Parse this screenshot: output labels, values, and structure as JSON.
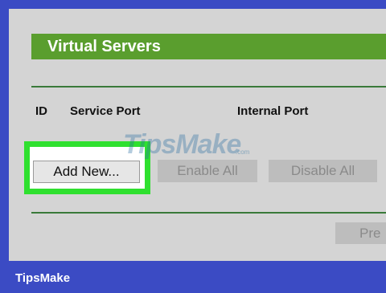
{
  "header": {
    "title": "Virtual Servers"
  },
  "columns": {
    "id": "ID",
    "service_port": "Service Port",
    "internal_port": "Internal Port"
  },
  "buttons": {
    "add_new": "Add New...",
    "enable_all": "Enable All",
    "disable_all": "Disable All",
    "prev": "Pre"
  },
  "watermark": {
    "text": "TipsMake",
    "sub": ".com"
  },
  "brand": {
    "label": "TipsMake"
  },
  "colors": {
    "frame": "#3b4bc4",
    "header_green": "#5a9e2e",
    "highlight": "#2fe02f",
    "panel": "#d4d4d4"
  }
}
